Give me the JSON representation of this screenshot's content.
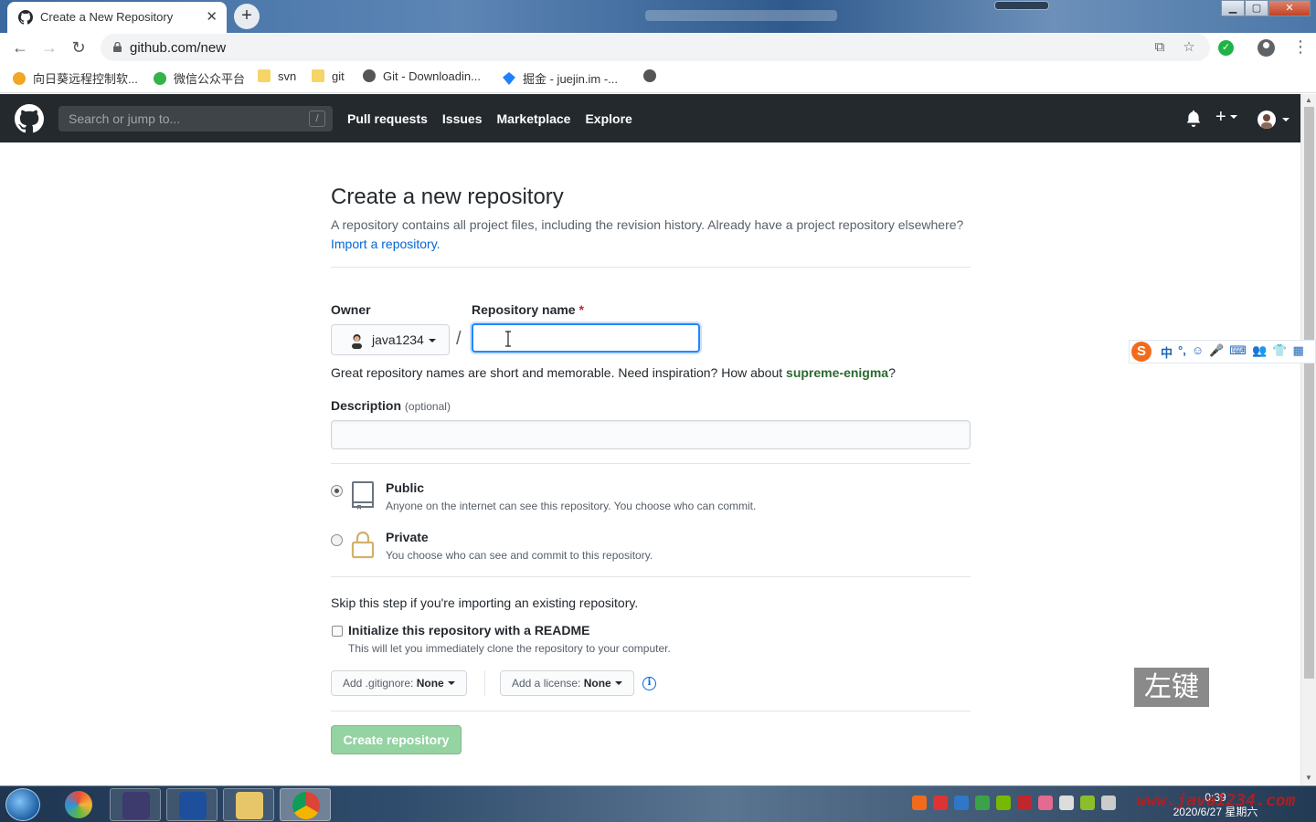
{
  "browser": {
    "tab_title": "Create a New Repository",
    "url": "github.com/new",
    "bookmarks": [
      {
        "label": "向日葵远程控制软..."
      },
      {
        "label": "微信公众平台"
      },
      {
        "label": "svn"
      },
      {
        "label": "git"
      },
      {
        "label": "Git - Downloadin..."
      },
      {
        "label": "掘金 - juejin.im -..."
      }
    ]
  },
  "header": {
    "search_placeholder": "Search or jump to...",
    "search_shortcut": "/",
    "nav": [
      "Pull requests",
      "Issues",
      "Marketplace",
      "Explore"
    ]
  },
  "form": {
    "title": "Create a new repository",
    "subhead": "A repository contains all project files, including the revision history. Already have a project repository elsewhere?",
    "import_link": "Import a repository.",
    "owner_label": "Owner",
    "owner_value": "java1234",
    "repo_label": "Repository name",
    "required_mark": "*",
    "separator": "/",
    "repo_value": "",
    "hint_prefix": "Great repository names are short and memorable. Need inspiration? How about",
    "hint_suggestion": "supreme-enigma",
    "hint_suffix": "?",
    "description_label": "Description",
    "description_optional": "(optional)",
    "description_value": "",
    "visibility": {
      "public_title": "Public",
      "public_desc": "Anyone on the internet can see this repository. You choose who can commit.",
      "private_title": "Private",
      "private_desc": "You choose who can see and commit to this repository.",
      "selected": "public"
    },
    "skip_text": "Skip this step if you're importing an existing repository.",
    "readme_label": "Initialize this repository with a README",
    "readme_desc": "This will let you immediately clone the repository to your computer.",
    "gitignore_label": "Add .gitignore:",
    "gitignore_value": "None",
    "license_label": "Add a license:",
    "license_value": "None",
    "info_glyph": "i",
    "create_button": "Create repository"
  },
  "overlay": {
    "click_label": "左键"
  },
  "ime": {
    "logo": "S",
    "items": [
      "中",
      "°,",
      "☺",
      "🎤",
      "⌨",
      "👥",
      "👕",
      "▦"
    ]
  },
  "taskbar": {
    "time": "0:39",
    "date": "2020/6/27 星期六",
    "watermark": "www.java1234.com"
  },
  "colors": {
    "github_header": "#24292e",
    "accent_blue": "#0366d6",
    "create_button_disabled": "#94d3a2",
    "focus_ring": "#2188ff"
  }
}
